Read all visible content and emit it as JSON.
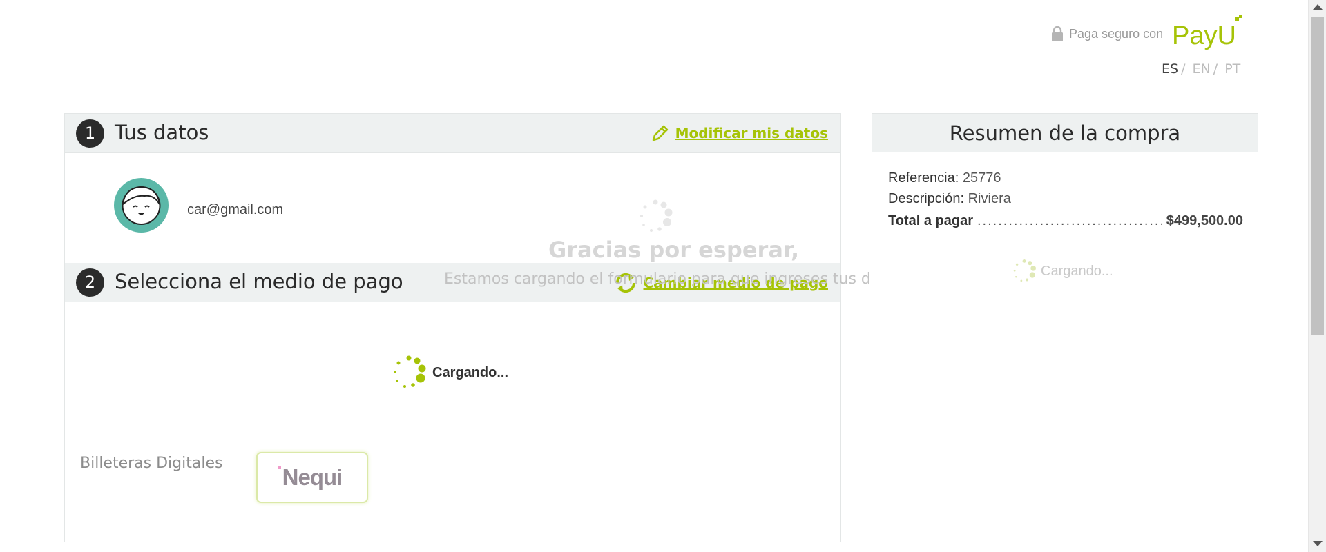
{
  "header": {
    "secure_text": "Paga seguro con",
    "brand": "PayU",
    "languages": [
      {
        "code": "ES",
        "active": true
      },
      {
        "code": "EN",
        "active": false
      },
      {
        "code": "PT",
        "active": false
      }
    ],
    "lang_separator": "/"
  },
  "step1": {
    "number": "1",
    "title": "Tus datos",
    "action_label": "Modificar mis datos",
    "action_icon": "pencil-icon",
    "email": "car@gmail.com"
  },
  "step2": {
    "number": "2",
    "title": "Selecciona el medio de pago",
    "action_label": "Cambiar medio de pago",
    "action_icon": "refresh-icon",
    "loading_label": "Cargando...",
    "wallet_label": "Billeteras Digitales",
    "wallet_option": "Nequi"
  },
  "overlay": {
    "title": "Gracias por esperar,",
    "subtitle": "Estamos cargando el formulario para que ingreses tus datos."
  },
  "summary": {
    "title": "Resumen de la compra",
    "reference_label": "Referencia:",
    "reference_value": "25776",
    "description_label": "Descripción:",
    "description_value": "Riviera",
    "total_label": "Total a pagar",
    "total_dots": "..............................................",
    "total_value": "$499,500.00",
    "loading_label": "Cargando..."
  },
  "colors": {
    "accent": "#a6c307",
    "bar_bg": "#eef1f1",
    "avatar_bg": "#5bb8a8",
    "nequi_dot": "#e23a96"
  }
}
